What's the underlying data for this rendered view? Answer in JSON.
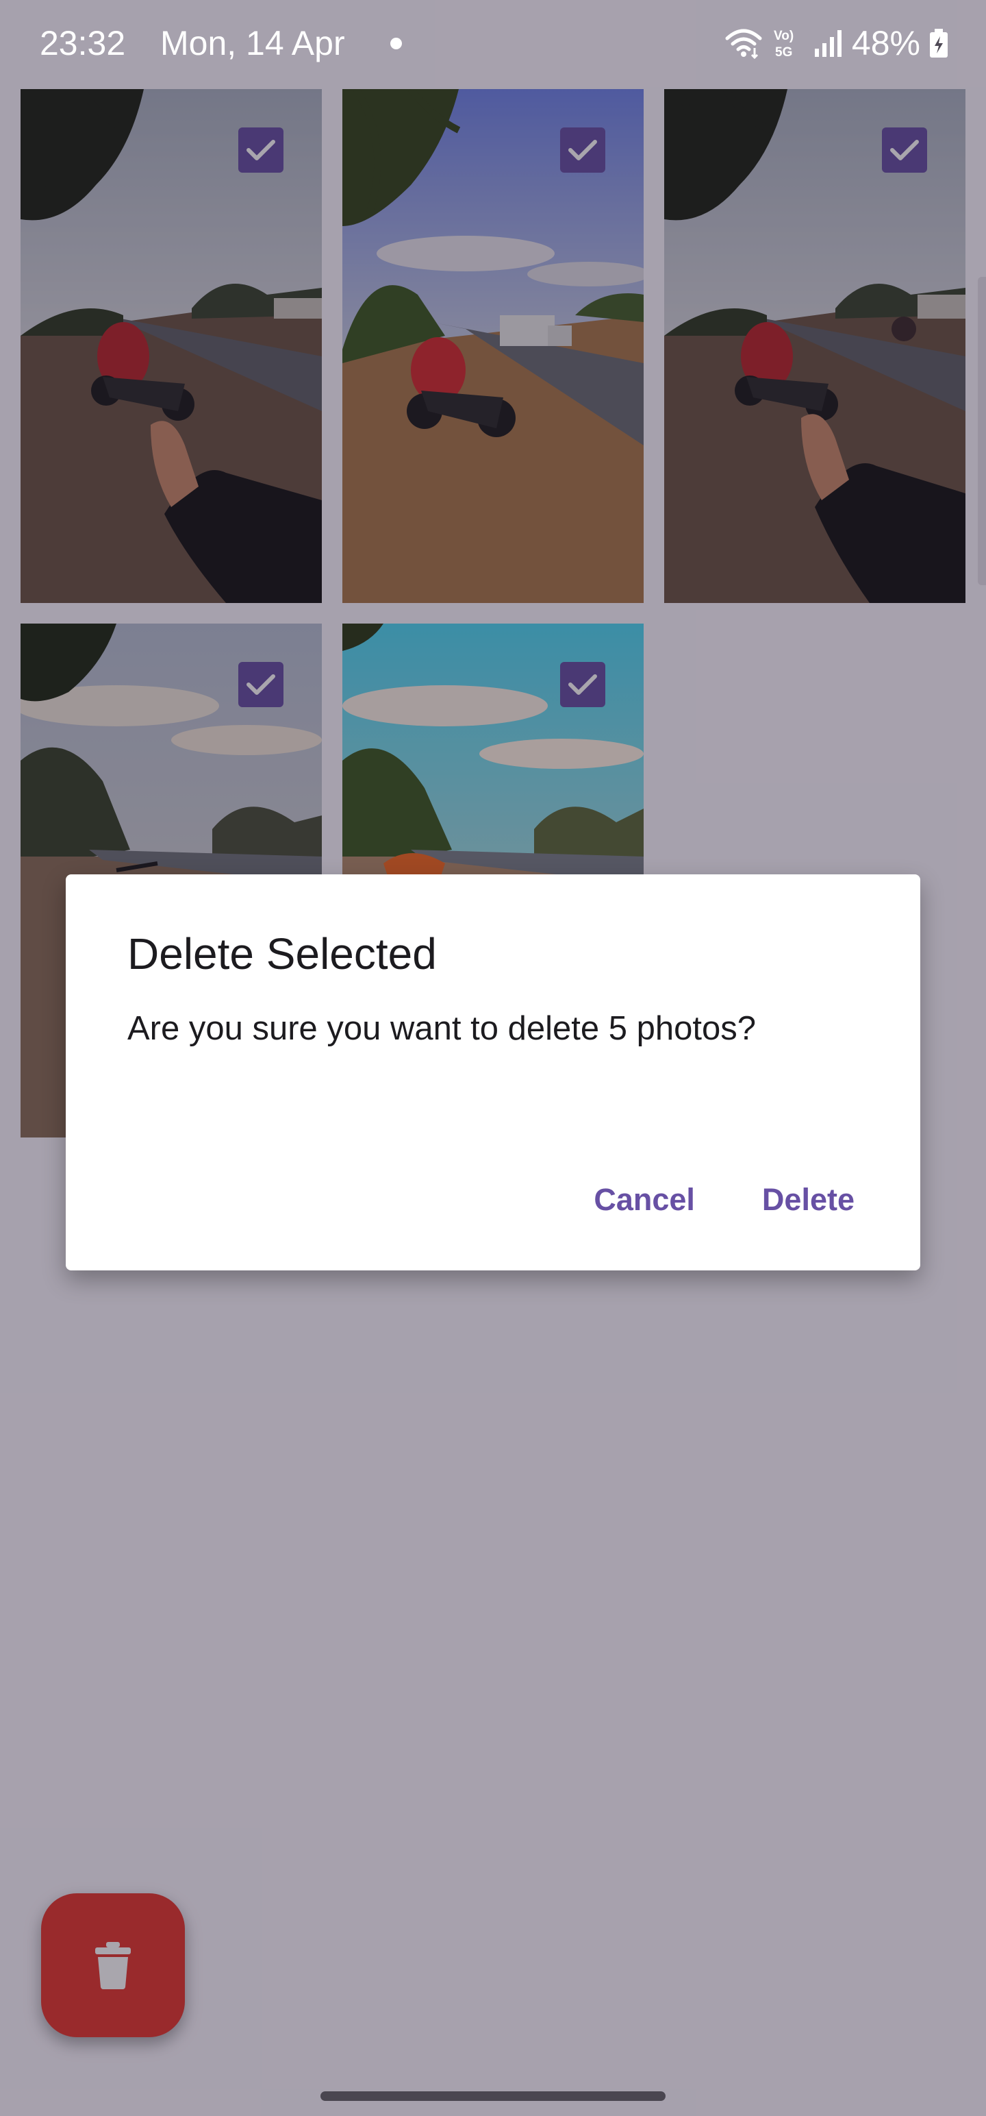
{
  "status_bar": {
    "time": "23:32",
    "date": "Mon, 14 Apr",
    "battery_percent": "48%",
    "icons": [
      "wifi-icon",
      "volte-5g-icon",
      "signal-icon",
      "battery-charging-icon"
    ]
  },
  "gallery": {
    "selected_count": 5,
    "photos": [
      {
        "name": "photo-1",
        "selected": true
      },
      {
        "name": "photo-2",
        "selected": true
      },
      {
        "name": "photo-3",
        "selected": true
      },
      {
        "name": "photo-4",
        "selected": true
      },
      {
        "name": "photo-5",
        "selected": true
      }
    ]
  },
  "dialog": {
    "title": "Delete Selected",
    "message": "Are you sure you want to delete 5 photos?",
    "cancel_label": "Cancel",
    "delete_label": "Delete"
  },
  "fab": {
    "icon": "trash-icon",
    "color": "#E53830"
  },
  "colors": {
    "accent": "#6750A4",
    "fab": "#E53830",
    "dialog_bg": "#FFFFFF",
    "scrim": "rgba(30,22,40,0.38)"
  }
}
